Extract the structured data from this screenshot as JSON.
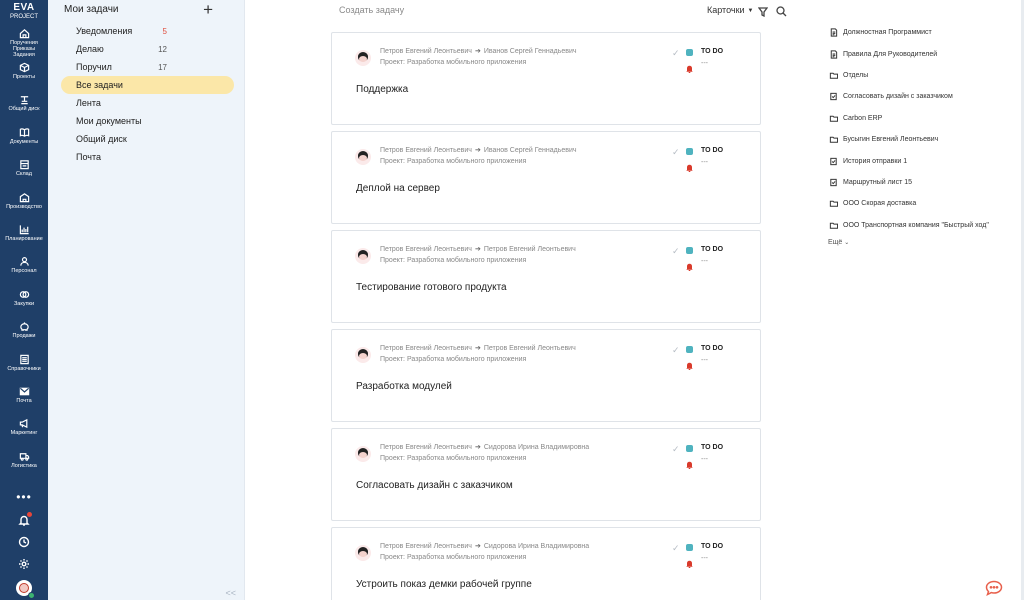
{
  "logo": {
    "line1": "EVA",
    "line2": "PROJECT"
  },
  "rail": [
    {
      "label": "Поручения\nПриказы\nЗадания",
      "icon": "home-icon"
    },
    {
      "label": "Проекты",
      "icon": "box-icon"
    },
    {
      "label": "Общий диск",
      "icon": "disk-icon"
    },
    {
      "label": "Документы",
      "icon": "book-icon"
    },
    {
      "label": "Склад",
      "icon": "warehouse-icon"
    },
    {
      "label": "Производство",
      "icon": "factory-icon"
    },
    {
      "label": "Планирование",
      "icon": "chart-icon"
    },
    {
      "label": "Персонал",
      "icon": "person-icon"
    },
    {
      "label": "Закупки",
      "icon": "coins-icon"
    },
    {
      "label": "Продажи",
      "icon": "piggy-icon"
    },
    {
      "label": "Справочники",
      "icon": "list-icon"
    },
    {
      "label": "Почта",
      "icon": "mail-icon"
    },
    {
      "label": "Маркетинг",
      "icon": "megaphone-icon"
    },
    {
      "label": "Логистика",
      "icon": "truck-icon"
    }
  ],
  "rail_more": "•••",
  "side": {
    "title": "Мои задачи",
    "add": "+",
    "items": [
      {
        "label": "Уведомления",
        "count": "5"
      },
      {
        "label": "Делаю",
        "count": "12"
      },
      {
        "label": "Поручил",
        "count": "17"
      },
      {
        "label": "Все задачи",
        "count": ""
      },
      {
        "label": "Лента",
        "count": ""
      },
      {
        "label": "Мои документы",
        "count": ""
      },
      {
        "label": "Общий диск",
        "count": ""
      },
      {
        "label": "Почта",
        "count": ""
      }
    ],
    "collapse": "<<"
  },
  "topbar": {
    "create_placeholder": "Создать задачу",
    "view": "Карточки"
  },
  "cards": [
    {
      "from": "Петров Евгений Леонтьевич",
      "to": "Иванов Сергей Геннадьевич",
      "project": "Проект: Разработка мобильного приложения",
      "status": "TO DO",
      "dash": "---",
      "title": "Поддержка"
    },
    {
      "from": "Петров Евгений Леонтьевич",
      "to": "Иванов Сергей Геннадьевич",
      "project": "Проект: Разработка мобильного приложения",
      "status": "TO DO",
      "dash": "---",
      "title": "Деплой на сервер"
    },
    {
      "from": "Петров Евгений Леонтьевич",
      "to": "Петров Евгений Леонтьевич",
      "project": "Проект: Разработка мобильного приложения",
      "status": "TO DO",
      "dash": "---",
      "title": "Тестирование готового продукта"
    },
    {
      "from": "Петров Евгений Леонтьевич",
      "to": "Петров Евгений Леонтьевич",
      "project": "Проект: Разработка мобильного приложения",
      "status": "TO DO",
      "dash": "---",
      "title": "Разработка модулей"
    },
    {
      "from": "Петров Евгений Леонтьевич",
      "to": "Сидорова Ирина Владимировна",
      "project": "Проект: Разработка мобильного приложения",
      "status": "TO DO",
      "dash": "---",
      "title": "Согласовать дизайн с заказчиком"
    },
    {
      "from": "Петров Евгений Леонтьевич",
      "to": "Сидорова Ирина Владимировна",
      "project": "Проект: Разработка мобильного приложения",
      "status": "TO DO",
      "dash": "---",
      "title": "Устроить показ демки рабочей группе"
    }
  ],
  "recent": [
    {
      "label": "Должностная Программист",
      "icon": "document-icon"
    },
    {
      "label": "Правила Для Руководителей",
      "icon": "document-icon"
    },
    {
      "label": "Отделы",
      "icon": "folder-icon"
    },
    {
      "label": "Согласовать дизайн с заказчиком",
      "icon": "task-icon"
    },
    {
      "label": "Carbon ERP",
      "icon": "folder-icon"
    },
    {
      "label": "Бусыгин Евгений Леонтьевич",
      "icon": "folder-icon"
    },
    {
      "label": "История отправки 1",
      "icon": "task-icon"
    },
    {
      "label": "Маршрутный лист 15",
      "icon": "task-icon"
    },
    {
      "label": "ООО Скорая доставка",
      "icon": "folder-icon"
    },
    {
      "label": "ООО Транспортная компания \"Быстрый ход\"",
      "icon": "folder-icon"
    }
  ],
  "recent_more": "Ещё",
  "colors": {
    "rail": "#1f3f68",
    "side": "#eef4fa",
    "active": "#fbe7a8",
    "status": "#4fb3bf",
    "alert": "#d93a2b"
  }
}
